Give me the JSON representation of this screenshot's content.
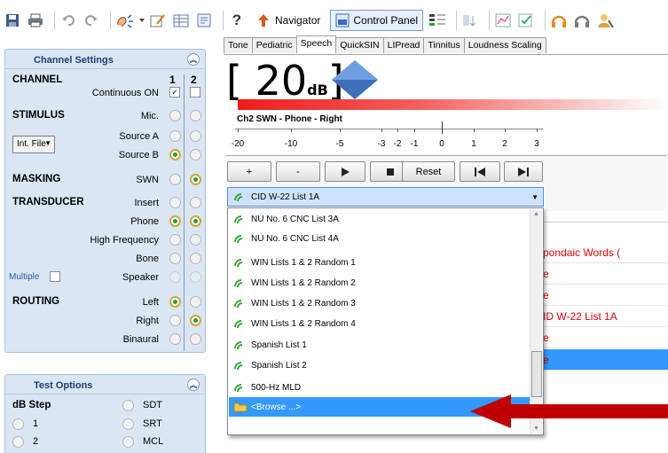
{
  "toolbar": {
    "navigator_label": "Navigator",
    "control_panel_label": "Control Panel"
  },
  "channel_settings": {
    "title": "Channel Settings",
    "col1": "1",
    "col2": "2",
    "channel_label": "CHANNEL",
    "continuous_on": "Continuous ON",
    "stimulus_label": "STIMULUS",
    "mic": "Mic.",
    "source_a": "Source A",
    "source_b": "Source B",
    "int_file": "Int. File",
    "masking_label": "MASKING",
    "swn": "SWN",
    "transducer_label": "TRANSDUCER",
    "insert": "Insert",
    "phone": "Phone",
    "high_frequency": "High Frequency",
    "bone": "Bone",
    "multiple": "Multiple",
    "speaker": "Speaker",
    "routing_label": "ROUTING",
    "left": "Left",
    "right": "Right",
    "binaural": "Binaural"
  },
  "test_options": {
    "title": "Test Options",
    "db_step": "dB Step",
    "sdt": "SDT",
    "srt": "SRT",
    "mcl": "MCL",
    "step1": "1",
    "step2": "2"
  },
  "tabs": [
    "Tone",
    "Pediatric",
    "Speech",
    "QuickSIN",
    "LIPread",
    "Tinnitus",
    "Loudness Scaling"
  ],
  "level": {
    "open": "[",
    "value": "20",
    "unit": "dB",
    "close": "]"
  },
  "channel2_label": "Ch2  SWN - Phone - Right",
  "scale_ticks": [
    "-20",
    "-10",
    "-5",
    "-3",
    "-2",
    "-1",
    "0",
    "1",
    "2",
    "3"
  ],
  "controls": {
    "plus": "+",
    "minus": "-",
    "reset": "Reset"
  },
  "selected_list": "CID W-22 List 1A",
  "dropdown_items": [
    "NU No. 6 CNC List 3A",
    "NU No. 6 CNC List 4A",
    "WIN Lists 1 & 2 Random 1",
    "WIN Lists 1 & 2 Random 2",
    "WIN Lists 1 & 2 Random 3",
    "WIN Lists 1 & 2 Random 4",
    "Spanish List 1",
    "Spanish List 2",
    "500-Hz MLD",
    "<Browse ...>"
  ],
  "right_cells": [
    "pondaic Words (",
    "e",
    "e",
    "ID W-22 List 1A",
    "e",
    "e"
  ],
  "colors": {
    "accent_red": "#e00000",
    "highlight_blue": "#3399ff",
    "panel_bg": "#dbe6f4"
  }
}
